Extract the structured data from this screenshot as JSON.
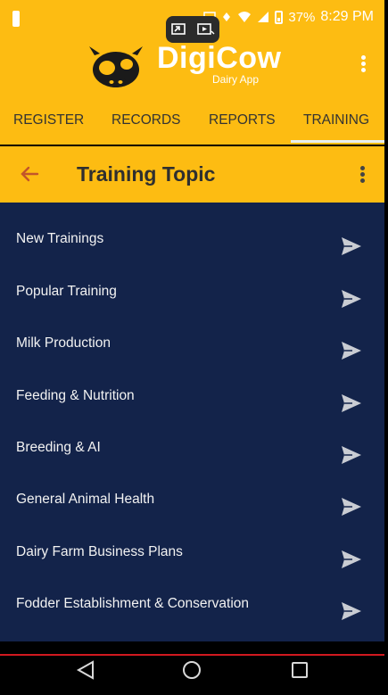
{
  "status_bar": {
    "battery_percent": "37%",
    "time": "8:29 PM"
  },
  "app": {
    "brand_name": "DigiCow",
    "brand_subtitle": "Dairy App"
  },
  "tabs": [
    {
      "label": "REGISTER",
      "selected": false
    },
    {
      "label": "RECORDS",
      "selected": false
    },
    {
      "label": "REPORTS",
      "selected": false
    },
    {
      "label": "TRAINING",
      "selected": true
    }
  ],
  "toolbar": {
    "title": "Training Topic"
  },
  "topics": [
    {
      "label": "New Trainings"
    },
    {
      "label": "Popular Training"
    },
    {
      "label": "Milk Production"
    },
    {
      "label": "Feeding  & Nutrition"
    },
    {
      "label": "Breeding &  AI"
    },
    {
      "label": "General Animal Health"
    },
    {
      "label": "Dairy Farm Business Plans"
    },
    {
      "label": "Fodder Establishment & Conservation"
    }
  ],
  "colors": {
    "accent_yellow": "#FDBC12",
    "list_background": "#13234a",
    "divider_red": "#d0181f"
  },
  "icons": {
    "back": "arrow-left-icon",
    "overflow": "more-vert-icon",
    "topic_action": "send-icon",
    "nav_back": "triangle-back-icon",
    "nav_home": "circle-home-icon",
    "nav_recents": "square-recents-icon"
  }
}
